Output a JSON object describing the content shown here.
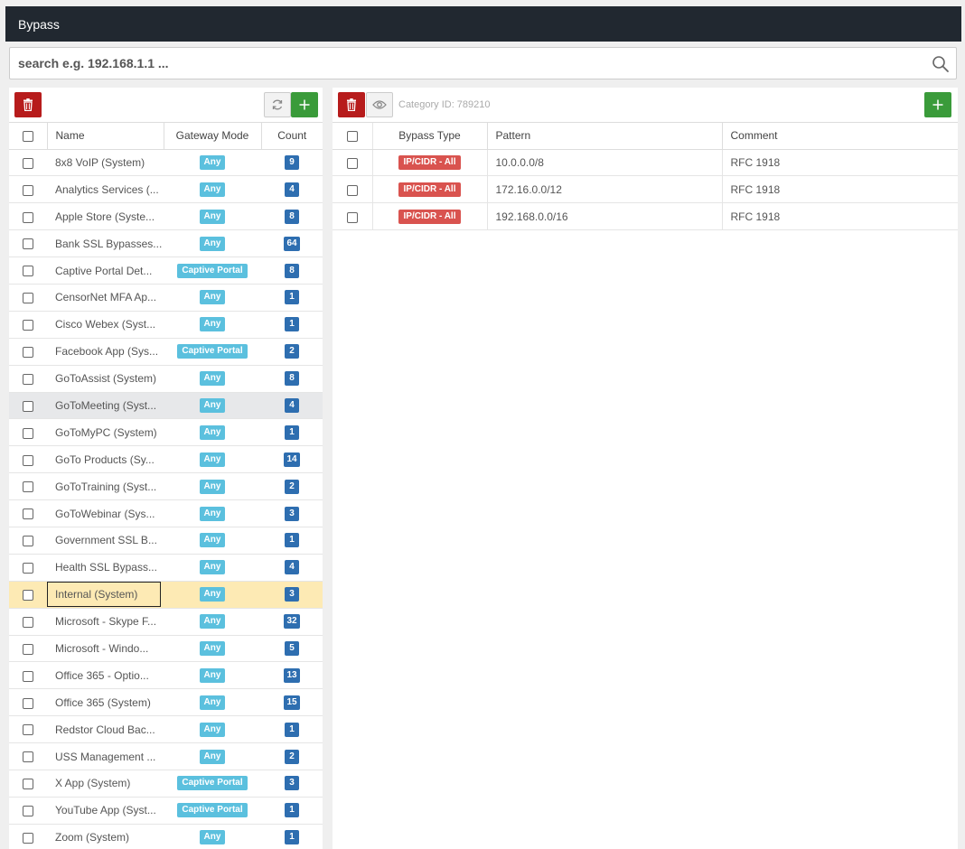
{
  "title": "Bypass",
  "search": {
    "placeholder": "search e.g. 192.168.1.1 ..."
  },
  "left": {
    "columns": {
      "name": "Name",
      "mode": "Gateway Mode",
      "count": "Count"
    },
    "rows": [
      {
        "name": "8x8 VoIP (System)",
        "mode": "Any",
        "count": "9"
      },
      {
        "name": "Analytics Services (...",
        "mode": "Any",
        "count": "4"
      },
      {
        "name": "Apple Store (Syste...",
        "mode": "Any",
        "count": "8"
      },
      {
        "name": "Bank SSL Bypasses...",
        "mode": "Any",
        "count": "64"
      },
      {
        "name": "Captive Portal Det...",
        "mode": "Captive Portal",
        "count": "8"
      },
      {
        "name": "CensorNet MFA Ap...",
        "mode": "Any",
        "count": "1"
      },
      {
        "name": "Cisco Webex (Syst...",
        "mode": "Any",
        "count": "1"
      },
      {
        "name": "Facebook App (Sys...",
        "mode": "Captive Portal",
        "count": "2"
      },
      {
        "name": "GoToAssist (System)",
        "mode": "Any",
        "count": "8"
      },
      {
        "name": "GoToMeeting (Syst...",
        "mode": "Any",
        "count": "4"
      },
      {
        "name": "GoToMyPC (System)",
        "mode": "Any",
        "count": "1"
      },
      {
        "name": "GoTo Products (Sy...",
        "mode": "Any",
        "count": "14"
      },
      {
        "name": "GoToTraining (Syst...",
        "mode": "Any",
        "count": "2"
      },
      {
        "name": "GoToWebinar (Sys...",
        "mode": "Any",
        "count": "3"
      },
      {
        "name": "Government SSL B...",
        "mode": "Any",
        "count": "1"
      },
      {
        "name": "Health SSL Bypass...",
        "mode": "Any",
        "count": "4"
      },
      {
        "name": "Internal (System)",
        "mode": "Any",
        "count": "3"
      },
      {
        "name": "Microsoft - Skype F...",
        "mode": "Any",
        "count": "32"
      },
      {
        "name": "Microsoft - Windo...",
        "mode": "Any",
        "count": "5"
      },
      {
        "name": "Office 365 - Optio...",
        "mode": "Any",
        "count": "13"
      },
      {
        "name": "Office 365 (System)",
        "mode": "Any",
        "count": "15"
      },
      {
        "name": "Redstor Cloud Bac...",
        "mode": "Any",
        "count": "1"
      },
      {
        "name": "USS Management ...",
        "mode": "Any",
        "count": "2"
      },
      {
        "name": "X App (System)",
        "mode": "Captive Portal",
        "count": "3"
      },
      {
        "name": "YouTube App (Syst...",
        "mode": "Captive Portal",
        "count": "1"
      },
      {
        "name": "Zoom (System)",
        "mode": "Any",
        "count": "1"
      }
    ]
  },
  "right": {
    "category_label": "Category ID: 789210",
    "columns": {
      "type": "Bypass Type",
      "pattern": "Pattern",
      "comment": "Comment"
    },
    "rows": [
      {
        "type": "IP/CIDR - All",
        "pattern": "10.0.0.0/8",
        "comment": "RFC 1918"
      },
      {
        "type": "IP/CIDR - All",
        "pattern": "172.16.0.0/12",
        "comment": "RFC 1918"
      },
      {
        "type": "IP/CIDR - All",
        "pattern": "192.168.0.0/16",
        "comment": "RFC 1918"
      }
    ]
  },
  "colors": {
    "danger": "#b71c1c",
    "success": "#3a9b3a",
    "info": "#5bc0de",
    "count": "#2e6eb0",
    "selected": "#fdeab4",
    "titlebar": "#212830"
  },
  "icons": {
    "delete": "trash-icon",
    "refresh": "refresh-icon",
    "add": "plus-icon",
    "view": "eye-icon",
    "search": "search-icon"
  }
}
